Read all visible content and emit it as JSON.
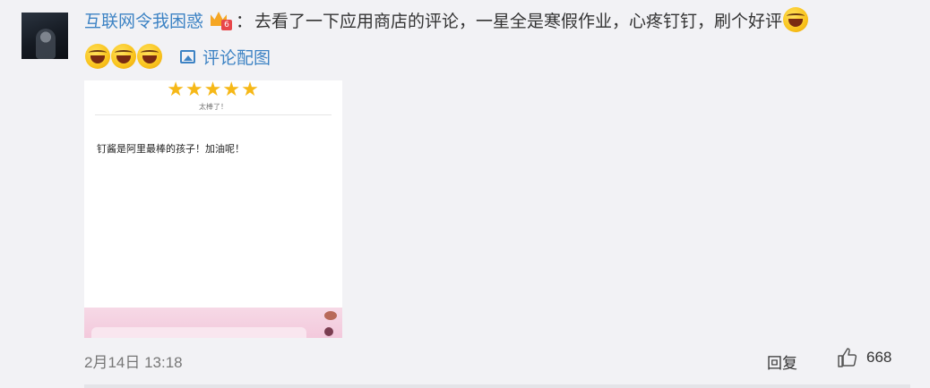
{
  "comment": {
    "username": "互联网令我困惑",
    "level_badge": "6",
    "colon": "：",
    "text": "去看了一下应用商店的评论，一星全是寒假作业，心疼钉钉，刷个好评",
    "view_image_label": "评论配图",
    "emoji_name": "laughing-tears-icon",
    "image": {
      "stars": "★★★★★",
      "stars_caption": "太棒了！",
      "review_text": "钉酱是阿里最棒的孩子！加油呢！"
    },
    "timestamp": "2月14日 13:18",
    "reply_label": "回复",
    "like_count": "668"
  },
  "colors": {
    "link": "#3d83c4",
    "star": "#f6b817",
    "background": "#f2f2f5"
  }
}
